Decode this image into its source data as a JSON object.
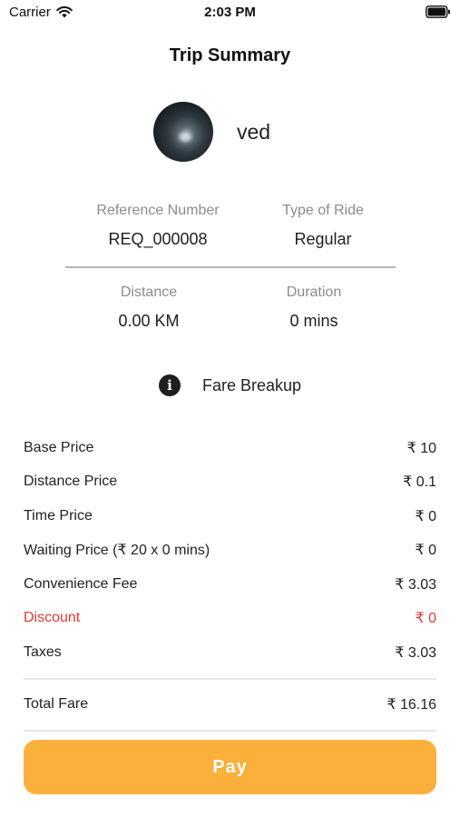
{
  "status_bar": {
    "carrier": "Carrier",
    "time": "2:03 PM",
    "wifi_icon": "wifi-icon",
    "battery_icon": "battery-icon"
  },
  "header": {
    "title": "Trip Summary"
  },
  "profile": {
    "name": "ved",
    "avatar_icon": "avatar"
  },
  "trip_info": {
    "reference_label": "Reference Number",
    "reference_value": "REQ_000008",
    "ride_type_label": "Type of Ride",
    "ride_type_value": "Regular",
    "distance_label": "Distance",
    "distance_value": "0.00 KM",
    "duration_label": "Duration",
    "duration_value": "0 mins"
  },
  "fare_breakup": {
    "icon": "info-icon",
    "label": "Fare Breakup",
    "items": [
      {
        "label": "Base Price",
        "value": "₹ 10"
      },
      {
        "label": "Distance Price",
        "value": "₹ 0.1"
      },
      {
        "label": "Time Price",
        "value": "₹ 0"
      },
      {
        "label": "Waiting Price (₹ 20 x 0 mins)",
        "value": "₹ 0"
      },
      {
        "label": "Convenience Fee",
        "value": "₹ 3.03"
      },
      {
        "label": "Discount",
        "value": "₹ 0"
      },
      {
        "label": "Taxes",
        "value": "₹ 3.03"
      }
    ],
    "total_label": "Total Fare",
    "total_value": "₹ 16.16"
  },
  "actions": {
    "pay_label": "Pay"
  },
  "colors": {
    "accent": "#fbb03b",
    "discount": "#e53935",
    "label_gray": "#8b8b8b"
  }
}
